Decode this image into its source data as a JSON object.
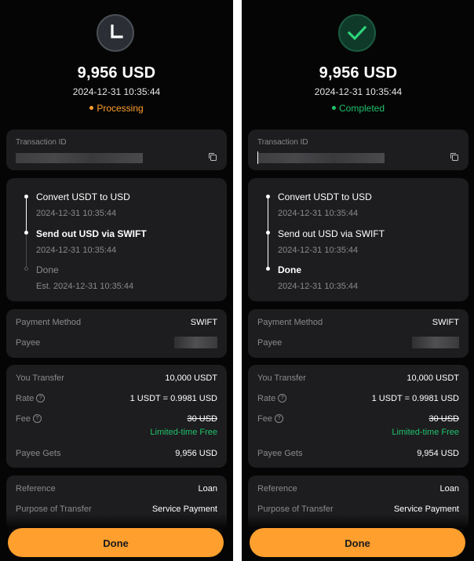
{
  "screens": [
    {
      "status": "Processing",
      "status_color": "#ff9f2e",
      "status_icon": "clock-icon",
      "amount": "9,956 USD",
      "timestamp": "2024-12-31 10:35:44",
      "transaction_id_label": "Transaction ID",
      "timeline": [
        {
          "title": "Convert USDT to USD",
          "time": "2024-12-31 10:35:44"
        },
        {
          "title": "Send out USD via SWIFT",
          "time": "2024-12-31 10:35:44"
        },
        {
          "title": "Done",
          "time": "Est. 2024-12-31 10:35:44"
        }
      ],
      "payment_method_label": "Payment Method",
      "payment_method": "SWIFT",
      "payee_label": "Payee",
      "you_transfer_label": "You Transfer",
      "you_transfer": "10,000 USDT",
      "rate_label": "Rate",
      "rate": "1 USDT = 0.9981 USD",
      "fee_label": "Fee",
      "fee_original": "30 USD",
      "fee_promo": "Limited-time Free",
      "payee_gets_label": "Payee Gets",
      "payee_gets": "9,956 USD",
      "reference_label": "Reference",
      "reference": "Loan",
      "purpose_label": "Purpose of Transfer",
      "purpose": "Service Payment",
      "done_button": "Done"
    },
    {
      "status": "Completed",
      "status_color": "#1fc16b",
      "status_icon": "checkmark-icon",
      "amount": "9,956 USD",
      "timestamp": "2024-12-31 10:35:44",
      "transaction_id_label": "Transaction ID",
      "timeline": [
        {
          "title": "Convert USDT to USD",
          "time": "2024-12-31 10:35:44"
        },
        {
          "title": "Send out USD via SWIFT",
          "time": "2024-12-31 10:35:44"
        },
        {
          "title": "Done",
          "time": "2024-12-31 10:35:44"
        }
      ],
      "payment_method_label": "Payment Method",
      "payment_method": "SWIFT",
      "payee_label": "Payee",
      "you_transfer_label": "You Transfer",
      "you_transfer": "10,000 USDT",
      "rate_label": "Rate",
      "rate": "1 USDT = 0.9981 USD",
      "fee_label": "Fee",
      "fee_original": "30 USD",
      "fee_promo": "Limited-time Free",
      "payee_gets_label": "Payee Gets",
      "payee_gets": "9,954 USD",
      "reference_label": "Reference",
      "reference": "Loan",
      "purpose_label": "Purpose of Transfer",
      "purpose": "Service Payment",
      "done_button": "Done"
    }
  ]
}
